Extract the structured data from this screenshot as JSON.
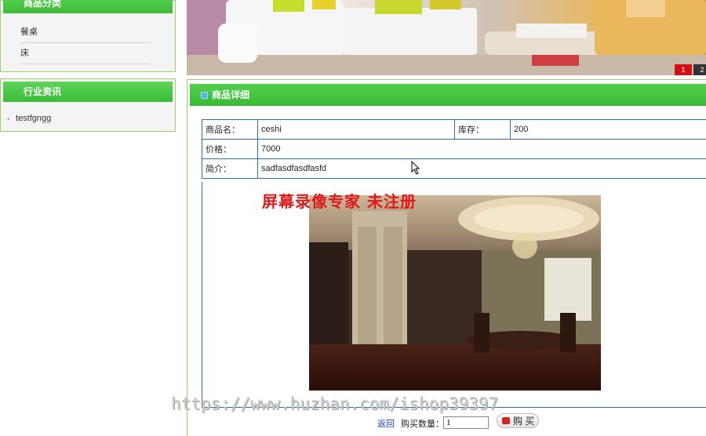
{
  "sidebar": {
    "category": {
      "title": "商品分类",
      "items": [
        {
          "label": "餐桌"
        },
        {
          "label": "床"
        }
      ]
    },
    "news": {
      "title": "行业资讯",
      "items": [
        {
          "label": "testfgngg"
        }
      ]
    }
  },
  "banner": {
    "pages": [
      "1",
      "2"
    ],
    "active_page": "1"
  },
  "detail": {
    "title": "商品详细",
    "name_label": "商品名：",
    "name_value": "ceshi",
    "stock_label": "库存：",
    "stock_value": "200",
    "price_label": "价格：",
    "price_value": "7000",
    "desc_label": "简介：",
    "desc_value": "sadfasdfasdfasfd"
  },
  "watermark": {
    "text": "屏幕录像专家  未注册",
    "url": "https://www.huzhan.com/ishop39397"
  },
  "actions": {
    "back_label": "返回",
    "qty_label": "购买数量：",
    "qty_value": "1",
    "buy_label": "购 买"
  },
  "colors": {
    "accent_green": "#3dbb38",
    "table_border": "#2d6fb0",
    "watermark_red": "#e01818"
  }
}
